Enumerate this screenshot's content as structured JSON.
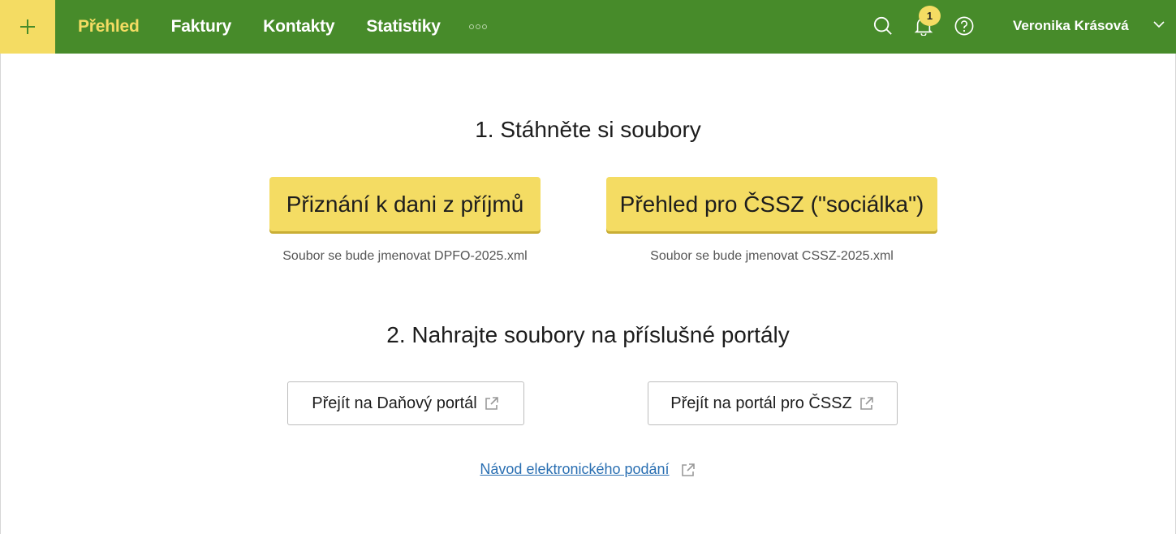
{
  "header": {
    "nav": [
      {
        "label": "Přehled",
        "active": true
      },
      {
        "label": "Faktury",
        "active": false
      },
      {
        "label": "Kontakty",
        "active": false
      },
      {
        "label": "Statistiky",
        "active": false
      }
    ],
    "notification_count": "1",
    "user_name": "Veronika Krásová",
    "colors": {
      "bar": "#478b2a",
      "accent": "#f4dc63"
    },
    "icons": [
      "plus-icon",
      "more-dots-icon",
      "search-icon",
      "bell-icon",
      "help-icon",
      "chevron-down-icon"
    ]
  },
  "step1": {
    "heading": "1. Stáhněte si soubory",
    "tax_button": "Přiznání k dani z příjmů",
    "tax_hint": "Soubor se bude jmenovat DPFO-2025.xml",
    "cssz_button": "Přehled pro ČSSZ (\"sociálka\")",
    "cssz_hint": "Soubor se bude jmenovat CSSZ-2025.xml"
  },
  "step2": {
    "heading": "2. Nahrajte soubory na příslušné portály",
    "tax_portal_button": "Přejít na Daňový portál",
    "cssz_portal_button": "Přejít na portál pro ČSSZ",
    "guide_link": "Návod elektronického podání"
  }
}
